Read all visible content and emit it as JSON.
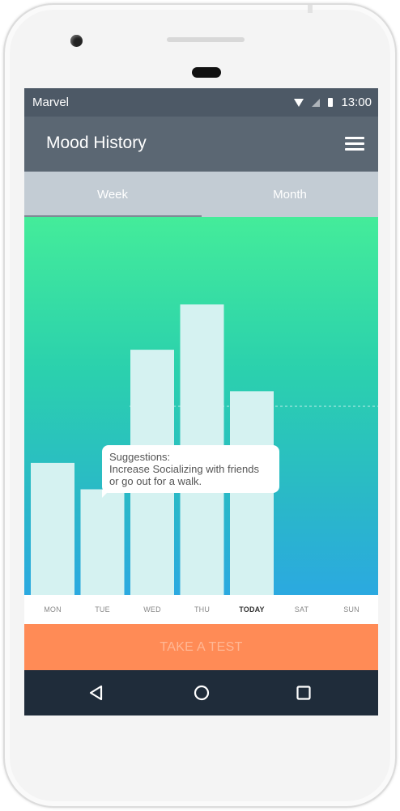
{
  "status_bar": {
    "carrier": "Marvel",
    "time": "13:00",
    "icons": [
      "wifi-icon",
      "signal-icon",
      "battery-icon"
    ]
  },
  "app_bar": {
    "title": "Mood History",
    "menu_icon": "menu-icon"
  },
  "tabs": [
    {
      "label": "Week",
      "active": true
    },
    {
      "label": "Month",
      "active": false
    }
  ],
  "chart_data": {
    "type": "bar",
    "categories": [
      "MON",
      "TUE",
      "WED",
      "THU",
      "TODAY",
      "SAT",
      "SUN"
    ],
    "values": [
      3.5,
      2.8,
      6.5,
      7.7,
      5.4,
      null,
      null
    ],
    "average": 5.0,
    "ylim": [
      0,
      10
    ],
    "highlighted_category": "TODAY",
    "grid": false,
    "colors": {
      "bar": "#d5f2f1",
      "gradient_top": "#44ec9a",
      "gradient_bottom": "#2ba9e0"
    }
  },
  "tooltip": {
    "title": "Suggestions:",
    "line1": "Increase Socializing with friends",
    "line2": "or go out for  a walk."
  },
  "cta": {
    "label": "TAKE A TEST",
    "color": "#ff8b56"
  },
  "nav_bar": {
    "icons": [
      "back-icon",
      "home-icon",
      "recent-apps-icon"
    ]
  }
}
